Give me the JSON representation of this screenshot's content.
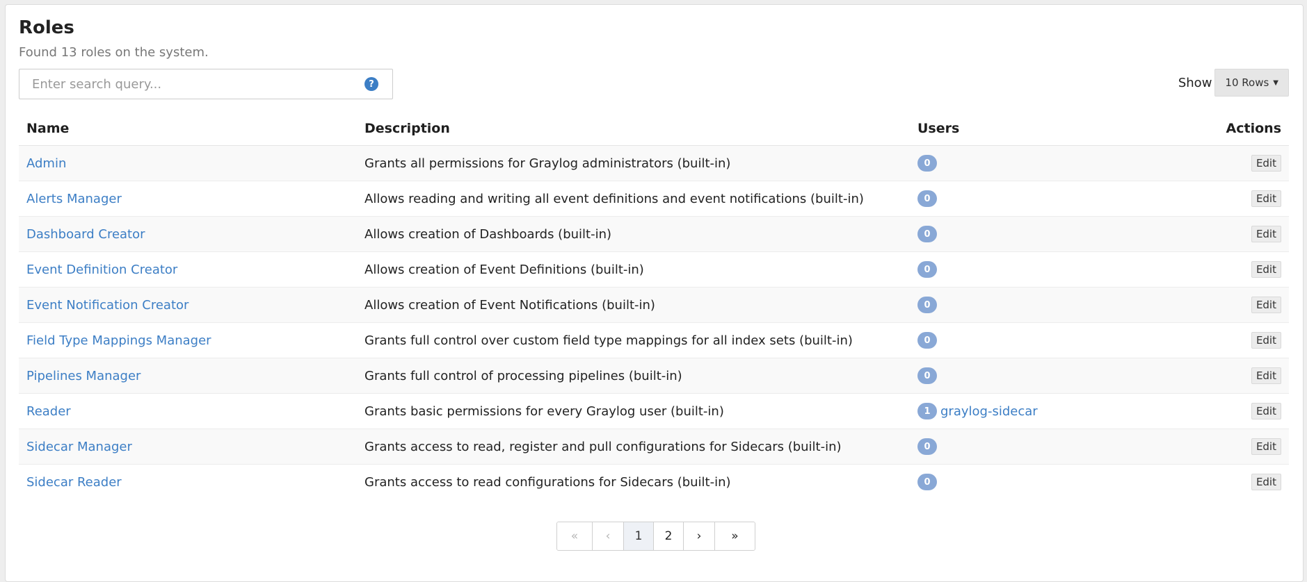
{
  "header": {
    "title": "Roles",
    "subtitle": "Found 13 roles on the system."
  },
  "search": {
    "placeholder": "Enter search query...",
    "help_icon": "question-circle-icon",
    "help_glyph": "?"
  },
  "page_size": {
    "label": "Show",
    "value": "10 Rows"
  },
  "table": {
    "columns": [
      "Name",
      "Description",
      "Users",
      "Actions"
    ],
    "rows": [
      {
        "name": "Admin",
        "description": "Grants all permissions for Graylog administrators (built-in)",
        "users": "0",
        "user_names": "",
        "action": "Edit"
      },
      {
        "name": "Alerts Manager",
        "description": "Allows reading and writing all event definitions and event notifications (built-in)",
        "users": "0",
        "user_names": "",
        "action": "Edit"
      },
      {
        "name": "Dashboard Creator",
        "description": "Allows creation of Dashboards (built-in)",
        "users": "0",
        "user_names": "",
        "action": "Edit"
      },
      {
        "name": "Event Definition Creator",
        "description": "Allows creation of Event Definitions (built-in)",
        "users": "0",
        "user_names": "",
        "action": "Edit"
      },
      {
        "name": "Event Notification Creator",
        "description": "Allows creation of Event Notifications (built-in)",
        "users": "0",
        "user_names": "",
        "action": "Edit"
      },
      {
        "name": "Field Type Mappings Manager",
        "description": "Grants full control over custom field type mappings for all index sets (built-in)",
        "users": "0",
        "user_names": "",
        "action": "Edit"
      },
      {
        "name": "Pipelines Manager",
        "description": "Grants full control of processing pipelines (built-in)",
        "users": "0",
        "user_names": "",
        "action": "Edit"
      },
      {
        "name": "Reader",
        "description": "Grants basic permissions for every Graylog user (built-in)",
        "users": "1",
        "user_names": "graylog-sidecar",
        "action": "Edit"
      },
      {
        "name": "Sidecar Manager",
        "description": "Grants access to read, register and pull configurations for Sidecars (built-in)",
        "users": "0",
        "user_names": "",
        "action": "Edit"
      },
      {
        "name": "Sidecar Reader",
        "description": "Grants access to read configurations for Sidecars (built-in)",
        "users": "0",
        "user_names": "",
        "action": "Edit"
      }
    ]
  },
  "pagination": {
    "first": "«",
    "prev": "‹",
    "pages": [
      "1",
      "2"
    ],
    "current_page": "1",
    "next": "›",
    "last": "»"
  },
  "colors": {
    "link": "#3c7ec5",
    "badge": "#89a8d6"
  }
}
